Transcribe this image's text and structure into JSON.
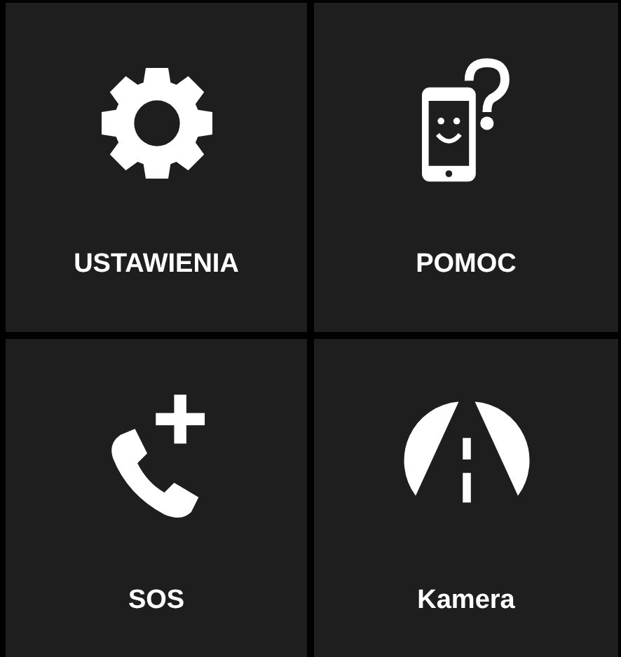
{
  "tiles": [
    {
      "label": "USTAWIENIA",
      "kind": "gear"
    },
    {
      "label": "POMOC",
      "kind": "help-phone"
    },
    {
      "label": "SOS",
      "kind": "phone-plus"
    },
    {
      "label": "Kamera",
      "kind": "road"
    }
  ]
}
